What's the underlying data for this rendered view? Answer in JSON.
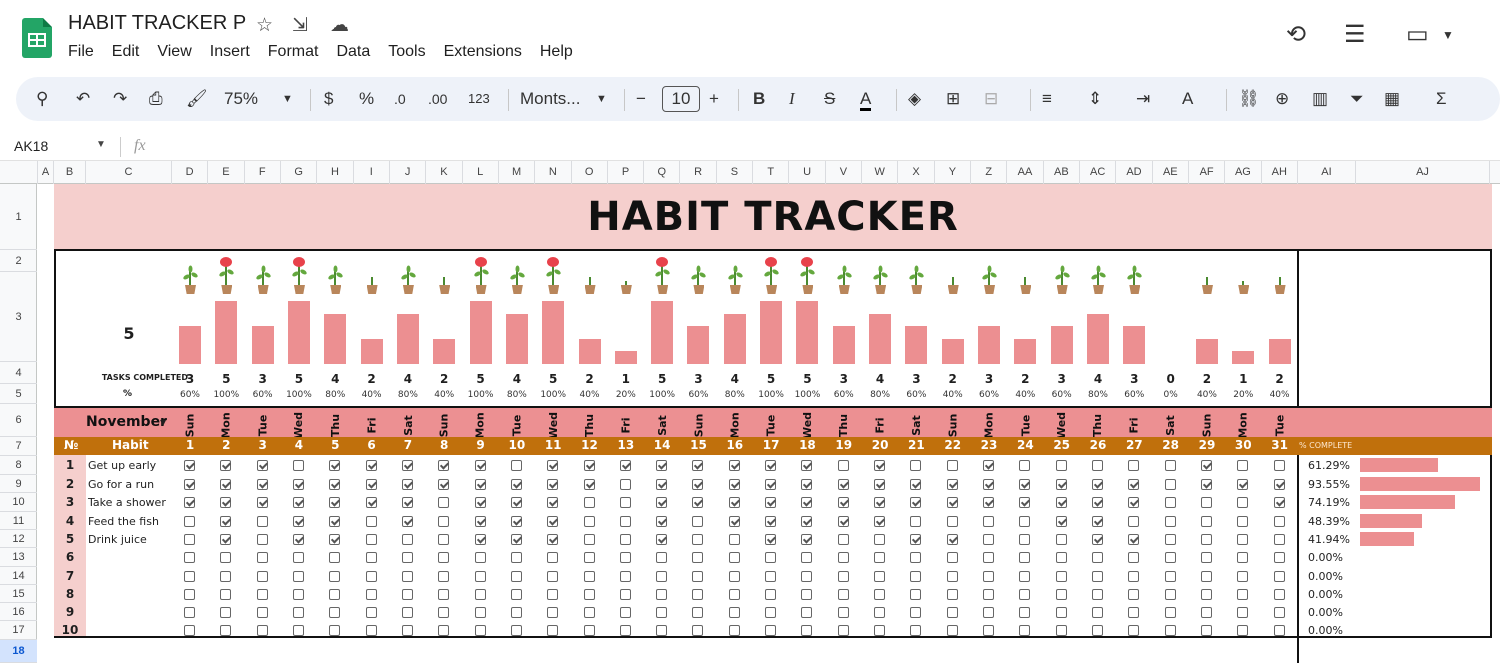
{
  "app": {
    "title": "HABIT TRACKER P",
    "menu": [
      "File",
      "Edit",
      "View",
      "Insert",
      "Format",
      "Data",
      "Tools",
      "Extensions",
      "Help"
    ]
  },
  "toolbar": {
    "zoom": "75%",
    "currency": "$",
    "percent": "%",
    "dec_dec": ".0",
    "dec_inc": ".00",
    "num_format": "123",
    "font": "Monts...",
    "font_size": "10"
  },
  "formula_bar": {
    "name_box": "AK18",
    "fx": "fx"
  },
  "columns": [
    "A",
    "B",
    "C",
    "D",
    "E",
    "F",
    "G",
    "H",
    "I",
    "J",
    "K",
    "L",
    "M",
    "N",
    "O",
    "P",
    "Q",
    "R",
    "S",
    "T",
    "U",
    "V",
    "W",
    "X",
    "Y",
    "Z",
    "AA",
    "AB",
    "AC",
    "AD",
    "AE",
    "AF",
    "AG",
    "AH",
    "AI",
    "AJ"
  ],
  "rows": [
    "1",
    "2",
    "3",
    "4",
    "5",
    "6",
    "7",
    "8",
    "9",
    "10",
    "11",
    "12",
    "13",
    "14",
    "15",
    "16",
    "17",
    "18"
  ],
  "sheet": {
    "title": "HABIT TRACKER",
    "big_number": "5",
    "tasks_label": "TASKS COMPLETED",
    "pct_label": "%",
    "month": "November",
    "num_header": "№",
    "habit_header": "Habit",
    "pct_complete_header": "% COMPLETE",
    "days_of_week": [
      "Sun",
      "Mon",
      "Tue",
      "Wed",
      "Thu",
      "Fri",
      "Sat",
      "Sun",
      "Mon",
      "Tue",
      "Wed",
      "Thu",
      "Fri",
      "Sat",
      "Sun",
      "Mon",
      "Tue",
      "Wed",
      "Thu",
      "Fri",
      "Sat",
      "Sun",
      "Mon",
      "Tue",
      "Wed",
      "Thu",
      "Fri",
      "Sat",
      "Sun",
      "Mon",
      "Tue"
    ],
    "day_numbers": [
      "1",
      "2",
      "3",
      "4",
      "5",
      "6",
      "7",
      "8",
      "9",
      "10",
      "11",
      "12",
      "13",
      "14",
      "15",
      "16",
      "17",
      "18",
      "19",
      "20",
      "21",
      "22",
      "23",
      "24",
      "25",
      "26",
      "27",
      "28",
      "29",
      "30",
      "31"
    ],
    "tasks_completed": [
      "3",
      "5",
      "3",
      "5",
      "4",
      "2",
      "4",
      "2",
      "5",
      "4",
      "5",
      "2",
      "1",
      "5",
      "3",
      "4",
      "5",
      "5",
      "3",
      "4",
      "3",
      "2",
      "3",
      "2",
      "3",
      "4",
      "3",
      "0",
      "2",
      "1",
      "2"
    ],
    "tasks_pct": [
      "60%",
      "100%",
      "60%",
      "100%",
      "80%",
      "40%",
      "80%",
      "40%",
      "100%",
      "80%",
      "100%",
      "40%",
      "20%",
      "100%",
      "60%",
      "80%",
      "100%",
      "100%",
      "60%",
      "80%",
      "60%",
      "40%",
      "60%",
      "40%",
      "60%",
      "80%",
      "60%",
      "0%",
      "40%",
      "20%",
      "40%"
    ],
    "habits": [
      {
        "num": "1",
        "name": "Get up early",
        "pct": "61.29%",
        "fraction": 0.6129,
        "checks": [
          1,
          1,
          1,
          0,
          1,
          1,
          1,
          1,
          1,
          0,
          1,
          1,
          1,
          1,
          1,
          1,
          1,
          1,
          0,
          1,
          0,
          0,
          1,
          0,
          0,
          0,
          0,
          0,
          1,
          0,
          0
        ]
      },
      {
        "num": "2",
        "name": "Go for a run",
        "pct": "93.55%",
        "fraction": 0.9355,
        "checks": [
          1,
          1,
          1,
          1,
          1,
          1,
          1,
          1,
          1,
          1,
          1,
          1,
          0,
          1,
          1,
          1,
          1,
          1,
          1,
          1,
          1,
          1,
          1,
          1,
          1,
          1,
          1,
          0,
          1,
          1,
          1
        ]
      },
      {
        "num": "3",
        "name": "Take a shower",
        "pct": "74.19%",
        "fraction": 0.7419,
        "checks": [
          1,
          1,
          1,
          1,
          1,
          1,
          1,
          0,
          1,
          1,
          1,
          0,
          0,
          1,
          1,
          1,
          1,
          1,
          1,
          1,
          1,
          1,
          1,
          1,
          1,
          1,
          1,
          0,
          0,
          0,
          1
        ]
      },
      {
        "num": "4",
        "name": "Feed the fish",
        "pct": "48.39%",
        "fraction": 0.4839,
        "checks": [
          0,
          1,
          0,
          1,
          1,
          0,
          1,
          0,
          1,
          1,
          1,
          0,
          0,
          1,
          0,
          1,
          1,
          1,
          1,
          1,
          0,
          0,
          0,
          0,
          1,
          1,
          0,
          0,
          0,
          0,
          0
        ]
      },
      {
        "num": "5",
        "name": "Drink juice",
        "pct": "41.94%",
        "fraction": 0.4194,
        "checks": [
          0,
          1,
          0,
          1,
          1,
          0,
          0,
          0,
          1,
          1,
          1,
          0,
          0,
          1,
          0,
          0,
          1,
          1,
          0,
          0,
          1,
          1,
          0,
          0,
          0,
          1,
          1,
          0,
          0,
          0,
          0
        ]
      },
      {
        "num": "6",
        "name": "",
        "pct": "0.00%",
        "fraction": 0,
        "checks": [
          0,
          0,
          0,
          0,
          0,
          0,
          0,
          0,
          0,
          0,
          0,
          0,
          0,
          0,
          0,
          0,
          0,
          0,
          0,
          0,
          0,
          0,
          0,
          0,
          0,
          0,
          0,
          0,
          0,
          0,
          0
        ]
      },
      {
        "num": "7",
        "name": "",
        "pct": "0.00%",
        "fraction": 0,
        "checks": [
          0,
          0,
          0,
          0,
          0,
          0,
          0,
          0,
          0,
          0,
          0,
          0,
          0,
          0,
          0,
          0,
          0,
          0,
          0,
          0,
          0,
          0,
          0,
          0,
          0,
          0,
          0,
          0,
          0,
          0,
          0
        ]
      },
      {
        "num": "8",
        "name": "",
        "pct": "0.00%",
        "fraction": 0,
        "checks": [
          0,
          0,
          0,
          0,
          0,
          0,
          0,
          0,
          0,
          0,
          0,
          0,
          0,
          0,
          0,
          0,
          0,
          0,
          0,
          0,
          0,
          0,
          0,
          0,
          0,
          0,
          0,
          0,
          0,
          0,
          0
        ]
      },
      {
        "num": "9",
        "name": "",
        "pct": "0.00%",
        "fraction": 0,
        "checks": [
          0,
          0,
          0,
          0,
          0,
          0,
          0,
          0,
          0,
          0,
          0,
          0,
          0,
          0,
          0,
          0,
          0,
          0,
          0,
          0,
          0,
          0,
          0,
          0,
          0,
          0,
          0,
          0,
          0,
          0,
          0
        ]
      },
      {
        "num": "10",
        "name": "",
        "pct": "0.00%",
        "fraction": 0,
        "checks": [
          0,
          0,
          0,
          0,
          0,
          0,
          0,
          0,
          0,
          0,
          0,
          0,
          0,
          0,
          0,
          0,
          0,
          0,
          0,
          0,
          0,
          0,
          0,
          0,
          0,
          0,
          0,
          0,
          0,
          0,
          0
        ]
      }
    ],
    "colors": {
      "title_band": "#f5cfcd",
      "bar": "#ec8f91",
      "month_band": "#ec9092",
      "header_band": "#c0700c"
    }
  }
}
